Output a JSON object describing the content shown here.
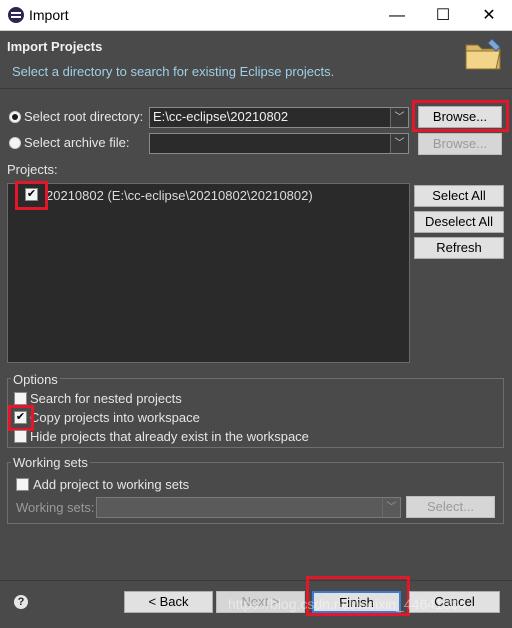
{
  "window": {
    "title": "Import",
    "minimize": "—",
    "maximize": "☐",
    "close": "✕"
  },
  "header": {
    "title": "Import Projects",
    "description": "Select a directory to search for existing Eclipse projects."
  },
  "source": {
    "root_label": "Select root directory:",
    "root_value": "E:\\cc-eclipse\\20210802",
    "root_selected": true,
    "archive_label": "Select archive file:",
    "archive_value": "",
    "browse_label": "Browse...",
    "browse_archive_label": "Browse..."
  },
  "projects": {
    "label": "Projects:",
    "items": [
      {
        "label": "20210802 (E:\\cc-eclipse\\20210802\\20210802)",
        "checked": true
      }
    ],
    "select_all": "Select All",
    "deselect_all": "Deselect All",
    "refresh": "Refresh"
  },
  "options": {
    "legend": "Options",
    "nested": {
      "label": "Search for nested projects",
      "checked": false
    },
    "copy": {
      "label": "Copy projects into workspace",
      "checked": true
    },
    "hide": {
      "label": "Hide projects that already exist in the workspace",
      "checked": false
    }
  },
  "working_sets": {
    "legend": "Working sets",
    "add_label": "Add project to working sets",
    "add_checked": false,
    "sets_label": "Working sets:",
    "select_button": "Select..."
  },
  "footer": {
    "help": "?",
    "back": "< Back",
    "next": "Next >",
    "finish": "Finish",
    "cancel": "Cancel"
  },
  "watermark": "https://blog.csdn.net/weixin_44641804",
  "colors": {
    "highlight": "#e3162a",
    "description": "#9fd0e8"
  }
}
